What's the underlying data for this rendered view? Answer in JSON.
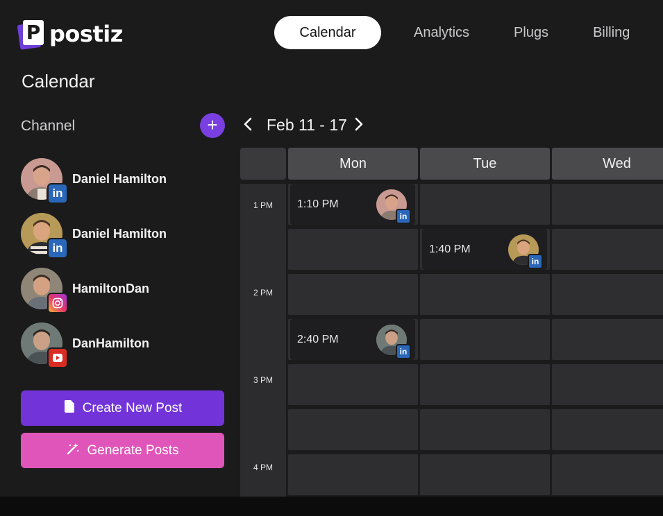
{
  "app": {
    "logo_letter": "P",
    "logo_text": "postiz"
  },
  "nav": {
    "tabs": [
      {
        "label": "Calendar",
        "active": true
      },
      {
        "label": "Analytics",
        "active": false
      },
      {
        "label": "Plugs",
        "active": false
      },
      {
        "label": "Billing",
        "active": false
      }
    ]
  },
  "page_title": "Calendar",
  "sidebar": {
    "channel_label": "Channel",
    "add_icon": "plus-icon",
    "channels": [
      {
        "name": "Daniel Hamilton",
        "platform": "linkedin",
        "badge_text": "in"
      },
      {
        "name": "Daniel Hamilton",
        "platform": "linkedin",
        "badge_text": "in"
      },
      {
        "name": "HamiltonDan",
        "platform": "instagram",
        "badge_text": ""
      },
      {
        "name": "DanHamilton",
        "platform": "youtube",
        "badge_text": ""
      }
    ],
    "create_label": "Create New Post",
    "generate_label": "Generate Posts"
  },
  "calendar": {
    "week_label": "Feb 11 - 17",
    "days": [
      "Mon",
      "Tue",
      "Wed"
    ],
    "time_labels": [
      "1 PM",
      "2 PM",
      "3 PM",
      "4 PM"
    ],
    "posts": [
      {
        "day": "Mon",
        "time": "1:10 PM",
        "platform": "linkedin",
        "badge_text": "in"
      },
      {
        "day": "Tue",
        "time": "1:40 PM",
        "platform": "linkedin",
        "badge_text": "in"
      },
      {
        "day": "Mon",
        "time": "2:40 PM",
        "platform": "linkedin",
        "badge_text": "in"
      }
    ]
  },
  "colors": {
    "background": "#1b1b1c",
    "accent_purple": "#7234d9",
    "accent_pink": "#e055b9",
    "linkedin": "#2a67b8",
    "youtube": "#d92d23"
  }
}
